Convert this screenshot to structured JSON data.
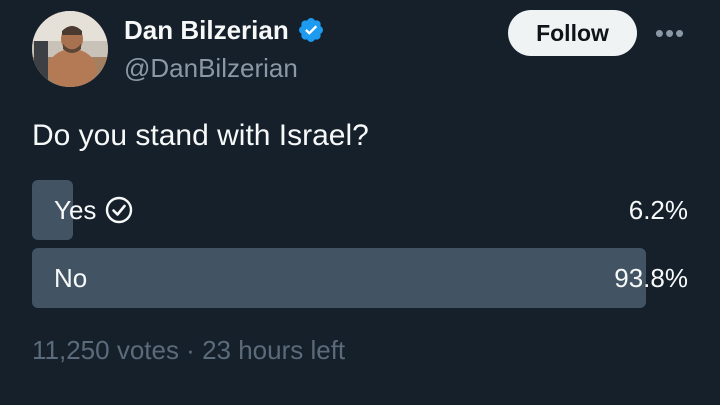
{
  "author": {
    "display_name": "Dan Bilzerian",
    "handle": "@DanBilzerian",
    "verified_icon": "verified-badge-icon",
    "badge_color": "#1d9bf0"
  },
  "header": {
    "follow_label": "Follow",
    "more_icon": "more-horizontal-icon",
    "more_glyph": "•••"
  },
  "poll": {
    "question": "Do you stand with Israel?",
    "options": [
      {
        "label": "Yes",
        "percent": "6.2%",
        "fraction": 0.062,
        "selected": true
      },
      {
        "label": "No",
        "percent": "93.8%",
        "fraction": 0.938,
        "selected": false
      }
    ],
    "meta": "11,250 votes · 23 hours left"
  },
  "colors": {
    "background": "#15202b",
    "bar": "#425363",
    "text": "#f7f9f9",
    "secondary_text": "#8b98a5",
    "meta_text": "#5b6b7b"
  }
}
